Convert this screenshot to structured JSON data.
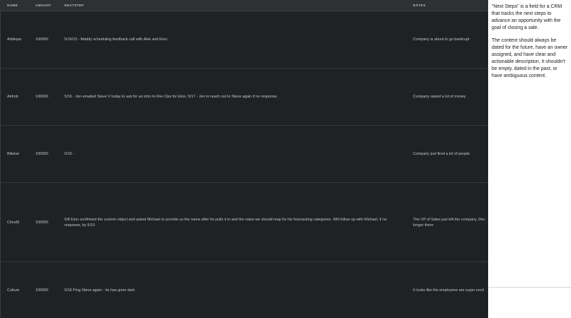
{
  "table": {
    "headers": {
      "name": "NAME",
      "amount": "AMOUNT",
      "nextstep": "NEXTSTEP",
      "notes": "NOTES"
    },
    "rows": [
      {
        "name": "Addepar",
        "amount": "100000",
        "nextstep": "5/16/23 - Maddy scheduling feedback call with Alek and Eton.",
        "notes": "Company is about to go bankrupt"
      },
      {
        "name": "Airbnb",
        "amount": "100000",
        "nextstep": "5/16 - Jen emailed Steve V today to ask for an intro to Rev Ops for Eton. 5/17 - Jen to reach out to Steve again if no response.",
        "notes": "Company raised a lot of money"
      },
      {
        "name": "Bitwise",
        "amount": "100000",
        "nextstep": "5/16 -",
        "notes": "Company just fired a lot of people"
      },
      {
        "name": "Cloud9",
        "amount": "100000",
        "nextstep": "5/8 Eton confirmed the custom object and asked Michael to provide us the name after he pulls it in and the value we should map for his forecasting categories. Will follow up with Michael, if no response, by 5/10",
        "notes": "The VP of Sales just left the company. Dec longer there"
      },
      {
        "name": "Culture",
        "amount": "100000",
        "nextstep": "5/16 Ping Steve again - he has gone dark",
        "notes": "It looks like the employees are super excit"
      }
    ]
  },
  "panel": {
    "paragraphs": [
      "\"Next Steps\" is a field for a CRM that tracks the next steps to advance an opportunity with the goal of closing a sale.",
      "The content should always be dated for the future, have an owner assigned, and have clear and actionable description. It shouldn't be empty, dated in the past, or have ambiguous content."
    ]
  }
}
